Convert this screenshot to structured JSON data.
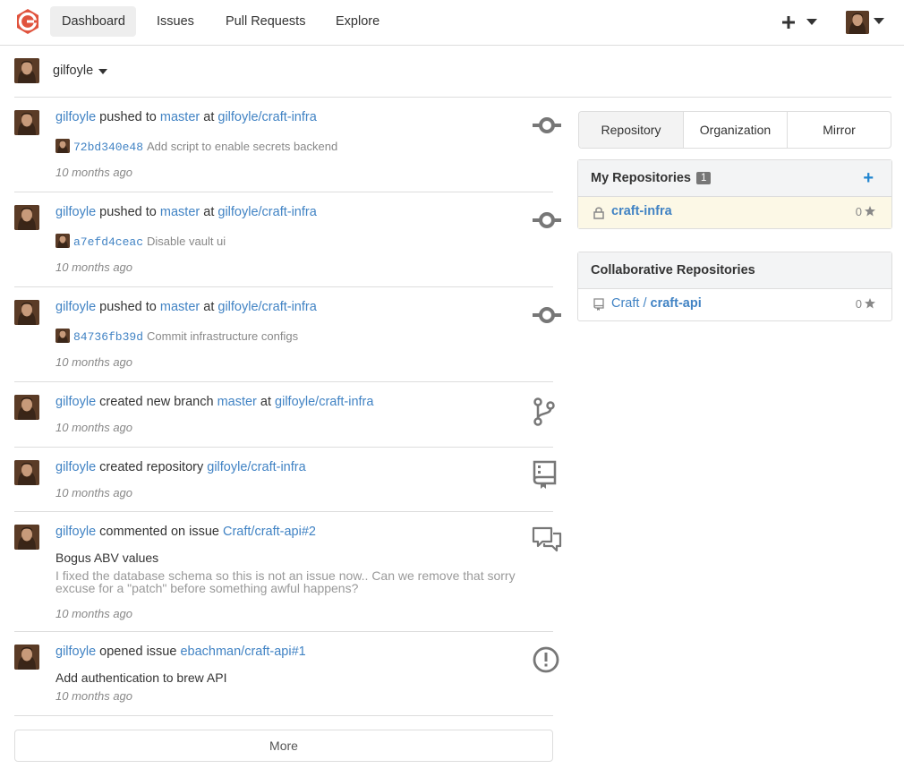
{
  "nav": {
    "items": [
      "Dashboard",
      "Issues",
      "Pull Requests",
      "Explore"
    ]
  },
  "context": {
    "user": "gilfoyle"
  },
  "feed": [
    {
      "user": "gilfoyle",
      "action": "pushed to",
      "ref": "master",
      "at": "at",
      "repo": "gilfoyle/craft-infra",
      "sha": "72bd340e48",
      "message": "Add script to enable secrets backend",
      "time": "10 months ago",
      "icon": "commit-icon"
    },
    {
      "user": "gilfoyle",
      "action": "pushed to",
      "ref": "master",
      "at": "at",
      "repo": "gilfoyle/craft-infra",
      "sha": "a7efd4ceac",
      "message": "Disable vault ui",
      "time": "10 months ago",
      "icon": "commit-icon"
    },
    {
      "user": "gilfoyle",
      "action": "pushed to",
      "ref": "master",
      "at": "at",
      "repo": "gilfoyle/craft-infra",
      "sha": "84736fb39d",
      "message": "Commit infrastructure configs",
      "time": "10 months ago",
      "icon": "commit-icon"
    },
    {
      "user": "gilfoyle",
      "action": "created new branch",
      "ref": "master",
      "at": "at",
      "repo": "gilfoyle/craft-infra",
      "time": "10 months ago",
      "icon": "git-branch-icon"
    },
    {
      "user": "gilfoyle",
      "action": "created repository",
      "repo": "gilfoyle/craft-infra",
      "time": "10 months ago",
      "icon": "repo-icon"
    },
    {
      "user": "gilfoyle",
      "action": "commented on issue",
      "repo": "Craft/craft-api#2",
      "title": "Bogus ABV values",
      "body": "I fixed the database schema so this is not an issue now.. Can we remove that sorry excuse for a \"patch\" before something awful happens?",
      "time": "10 months ago",
      "icon": "comment-discussion-icon"
    },
    {
      "user": "gilfoyle",
      "action": "opened issue",
      "repo": "ebachman/craft-api#1",
      "title": "Add authentication to brew API",
      "time": "10 months ago",
      "icon": "issue-opened-icon"
    }
  ],
  "more_label": "More",
  "repo_tabs": [
    "Repository",
    "Organization",
    "Mirror"
  ],
  "my_repos": {
    "title": "My Repositories",
    "count": "1",
    "items": [
      {
        "name": "craft-infra",
        "stars": "0",
        "private": true
      }
    ]
  },
  "collab_repos": {
    "title": "Collaborative Repositories",
    "items": [
      {
        "owner": "Craft /",
        "name": "craft-api",
        "stars": "0"
      }
    ]
  },
  "colors": {
    "link": "#4183c4",
    "logo": "#e0533d",
    "accent": "#2185d0"
  }
}
